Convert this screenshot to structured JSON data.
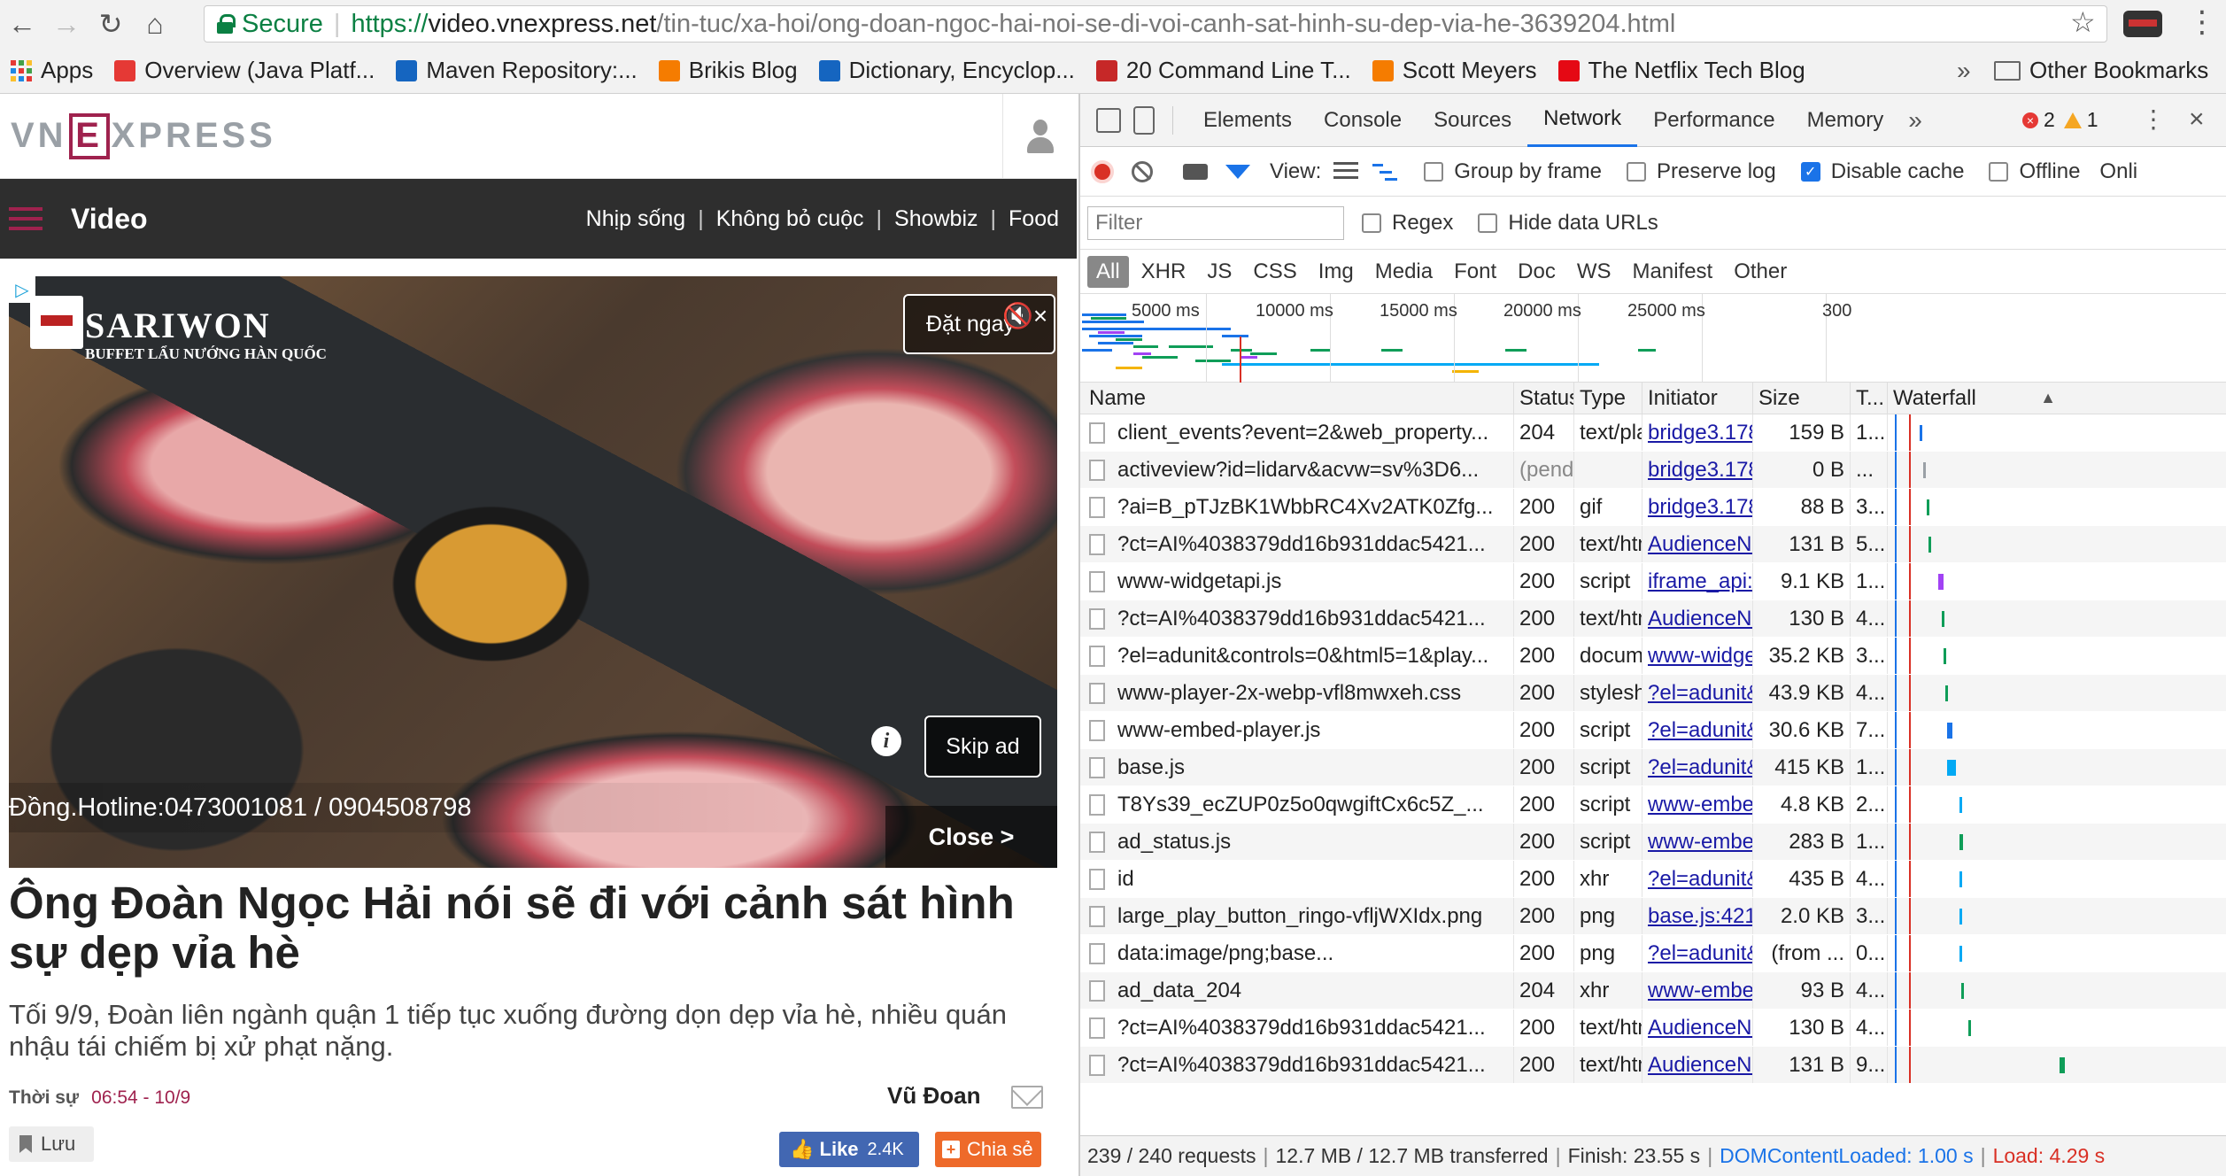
{
  "browser": {
    "secure_label": "Secure",
    "url_scheme": "https://",
    "url_host": "video.vnexpress.net",
    "url_path": "/tin-tuc/xa-hoi/ong-doan-ngoc-hai-noi-se-di-voi-canh-sat-hinh-su-dep-via-he-3639204.html",
    "bookmarks": [
      {
        "label": "Apps",
        "icon": "apps-grid-icon"
      },
      {
        "label": "Overview (Java Platf...",
        "icon": "java-icon",
        "color": "#e53935"
      },
      {
        "label": "Maven Repository:...",
        "icon": "maven-icon",
        "color": "#1565c0"
      },
      {
        "label": "Brikis Blog",
        "icon": "blogger-icon",
        "color": "#f57c00"
      },
      {
        "label": "Dictionary, Encyclop...",
        "icon": "dictionary-icon",
        "color": "#1565c0"
      },
      {
        "label": "20 Command Line T...",
        "icon": "tm-icon",
        "color": "#c62828"
      },
      {
        "label": "Scott Meyers",
        "icon": "blogger-icon",
        "color": "#f57c00"
      },
      {
        "label": "The Netflix Tech Blog",
        "icon": "netflix-icon",
        "color": "#e50914"
      }
    ],
    "bookmarks_more": "»",
    "other_bookmarks": "Other Bookmarks"
  },
  "page": {
    "logo_left": "VN",
    "logo_e": "E",
    "logo_right": "XPRESS",
    "section_title": "Video",
    "categories": [
      "Nhịp sống",
      "Không bỏ cuộc",
      "Showbiz",
      "Food"
    ],
    "ad": {
      "brand_name": "SARIWON",
      "brand_tagline": "BUFFET LẨU NƯỚNG HÀN QUỐC",
      "book_label": "Đặt ngay",
      "skip_label": "Skip ad",
      "hotline": "Đồng.Hotline:0473001081 / 0904508798",
      "close_label": "Close >"
    },
    "headline": "Ông Đoàn Ngọc Hải nói sẽ đi với cảnh sát hình sự dẹp vỉa hè",
    "lead": "Tối 9/9, Đoàn liên ngành quận 1 tiếp tục xuống đường dọn dẹp vỉa hè, nhiều quán nhậu tái chiếm bị xử phạt nặng.",
    "meta_category": "Thời sự",
    "meta_time": "06:54 - 10/9",
    "author": "Vũ Đoan",
    "save_label": "Lưu",
    "like_label": "Like",
    "like_count": "2.4K",
    "share_label": "Chia sẻ"
  },
  "devtools": {
    "tabs": [
      "Elements",
      "Console",
      "Sources",
      "Network",
      "Performance",
      "Memory"
    ],
    "active_tab": "Network",
    "more_tabs": "»",
    "error_count": "2",
    "warning_count": "1",
    "toolbar": {
      "view_label": "View:",
      "group_by_frame": "Group by frame",
      "preserve_log": "Preserve log",
      "disable_cache": "Disable cache",
      "offline": "Offline",
      "online": "Onli"
    },
    "filter_placeholder": "Filter",
    "regex_label": "Regex",
    "hide_data_urls": "Hide data URLs",
    "types": [
      "All",
      "XHR",
      "JS",
      "CSS",
      "Img",
      "Media",
      "Font",
      "Doc",
      "WS",
      "Manifest",
      "Other"
    ],
    "overview_ticks": [
      "5000 ms",
      "10000 ms",
      "15000 ms",
      "20000 ms",
      "25000 ms",
      "300"
    ],
    "columns": {
      "name": "Name",
      "status": "Status",
      "type": "Type",
      "initiator": "Initiator",
      "size": "Size",
      "time": "T...",
      "waterfall": "Waterfall"
    },
    "requests": [
      {
        "name": "client_events?event=2&web_property...",
        "status": "204",
        "type": "text/plain",
        "initiator": "bridge3.178.0...",
        "size": "159 B",
        "time": "1...",
        "wf_color": "#1a73e8",
        "wf_start": 0.18,
        "wf_width": 0.015
      },
      {
        "name": "activeview?id=lidarv&acvw=sv%3D6...",
        "status": "(pend...",
        "type": "",
        "initiator": "bridge3.178.0...",
        "size": "0 B",
        "time": "...",
        "wf_color": "#9aa0a6",
        "wf_start": 0.2,
        "wf_width": 0.0
      },
      {
        "name": "?ai=B_pTJzBK1WbbRC4Xv2ATK0Zfg...",
        "status": "200",
        "type": "gif",
        "initiator": "bridge3.178.0...",
        "size": "88 B",
        "time": "3...",
        "wf_color": "#0f9d58",
        "wf_start": 0.22,
        "wf_width": 0.012
      },
      {
        "name": "?ct=AI%4038379dd16b931ddac5421...",
        "status": "200",
        "type": "text/html",
        "initiator": "AudienceNetw...",
        "size": "131 B",
        "time": "5...",
        "wf_color": "#0f9d58",
        "wf_start": 0.23,
        "wf_width": 0.014
      },
      {
        "name": "www-widgetapi.js",
        "status": "200",
        "type": "script",
        "initiator": "iframe_api:2",
        "size": "9.1 KB",
        "time": "1...",
        "wf_color": "#a142f4",
        "wf_start": 0.28,
        "wf_width": 0.03
      },
      {
        "name": "?ct=AI%4038379dd16b931ddac5421...",
        "status": "200",
        "type": "text/html",
        "initiator": "AudienceNetw...",
        "size": "130 B",
        "time": "4...",
        "wf_color": "#0f9d58",
        "wf_start": 0.3,
        "wf_width": 0.012
      },
      {
        "name": "?el=adunit&controls=0&html5=1&play...",
        "status": "200",
        "type": "docum...",
        "initiator": "www-widgeta...",
        "size": "35.2 KB",
        "time": "3...",
        "wf_color": "#0f9d58",
        "wf_start": 0.31,
        "wf_width": 0.01
      },
      {
        "name": "www-player-2x-webp-vfl8mwxeh.css",
        "status": "200",
        "type": "stylesh...",
        "initiator": "?el=adunit&co...",
        "size": "43.9 KB",
        "time": "4...",
        "wf_color": "#0f9d58",
        "wf_start": 0.32,
        "wf_width": 0.014
      },
      {
        "name": "www-embed-player.js",
        "status": "200",
        "type": "script",
        "initiator": "?el=adunit&co...",
        "size": "30.6 KB",
        "time": "7...",
        "wf_color": "#1a73e8",
        "wf_start": 0.33,
        "wf_width": 0.03
      },
      {
        "name": "base.js",
        "status": "200",
        "type": "script",
        "initiator": "?el=adunit&co...",
        "size": "415 KB",
        "time": "1...",
        "wf_color": "#03a9f4",
        "wf_start": 0.33,
        "wf_width": 0.05
      },
      {
        "name": "T8Ys39_ecZUP0z5o0qwgiftCx6c5Z_...",
        "status": "200",
        "type": "script",
        "initiator": "www-embed-...",
        "size": "4.8 KB",
        "time": "2...",
        "wf_color": "#03a9f4",
        "wf_start": 0.4,
        "wf_width": 0.01
      },
      {
        "name": "ad_status.js",
        "status": "200",
        "type": "script",
        "initiator": "www-embed-...",
        "size": "283 B",
        "time": "1...",
        "wf_color": "#0f9d58",
        "wf_start": 0.4,
        "wf_width": 0.02
      },
      {
        "name": "id",
        "status": "200",
        "type": "xhr",
        "initiator": "?el=adunit&co...",
        "size": "435 B",
        "time": "4...",
        "wf_color": "#03a9f4",
        "wf_start": 0.4,
        "wf_width": 0.01
      },
      {
        "name": "large_play_button_ringo-vfljWXIdx.png",
        "status": "200",
        "type": "png",
        "initiator": "base.js:421",
        "size": "2.0 KB",
        "time": "3...",
        "wf_color": "#03a9f4",
        "wf_start": 0.4,
        "wf_width": 0.01
      },
      {
        "name": "data:image/png;base...",
        "status": "200",
        "type": "png",
        "initiator": "?el=adunit&co...",
        "size": "(from ...",
        "time": "0...",
        "wf_color": "#03a9f4",
        "wf_start": 0.4,
        "wf_width": 0.005
      },
      {
        "name": "ad_data_204",
        "status": "204",
        "type": "xhr",
        "initiator": "www-embed-...",
        "size": "93 B",
        "time": "4...",
        "wf_color": "#0f9d58",
        "wf_start": 0.41,
        "wf_width": 0.012
      },
      {
        "name": "?ct=AI%4038379dd16b931ddac5421...",
        "status": "200",
        "type": "text/html",
        "initiator": "AudienceNetw...",
        "size": "130 B",
        "time": "4...",
        "wf_color": "#0f9d58",
        "wf_start": 0.45,
        "wf_width": 0.012
      },
      {
        "name": "?ct=AI%4038379dd16b931ddac5421...",
        "status": "200",
        "type": "text/html",
        "initiator": "AudienceNetw...",
        "size": "131 B",
        "time": "9...",
        "wf_color": "#0f9d58",
        "wf_start": 0.96,
        "wf_width": 0.03
      }
    ],
    "summary": {
      "requests": "239 / 240 requests",
      "transferred": "12.7 MB / 12.7 MB transferred",
      "finish": "Finish: 23.55 s",
      "dom_loaded": "DOMContentLoaded: 1.00 s",
      "load": "Load: 4.29 s"
    }
  }
}
